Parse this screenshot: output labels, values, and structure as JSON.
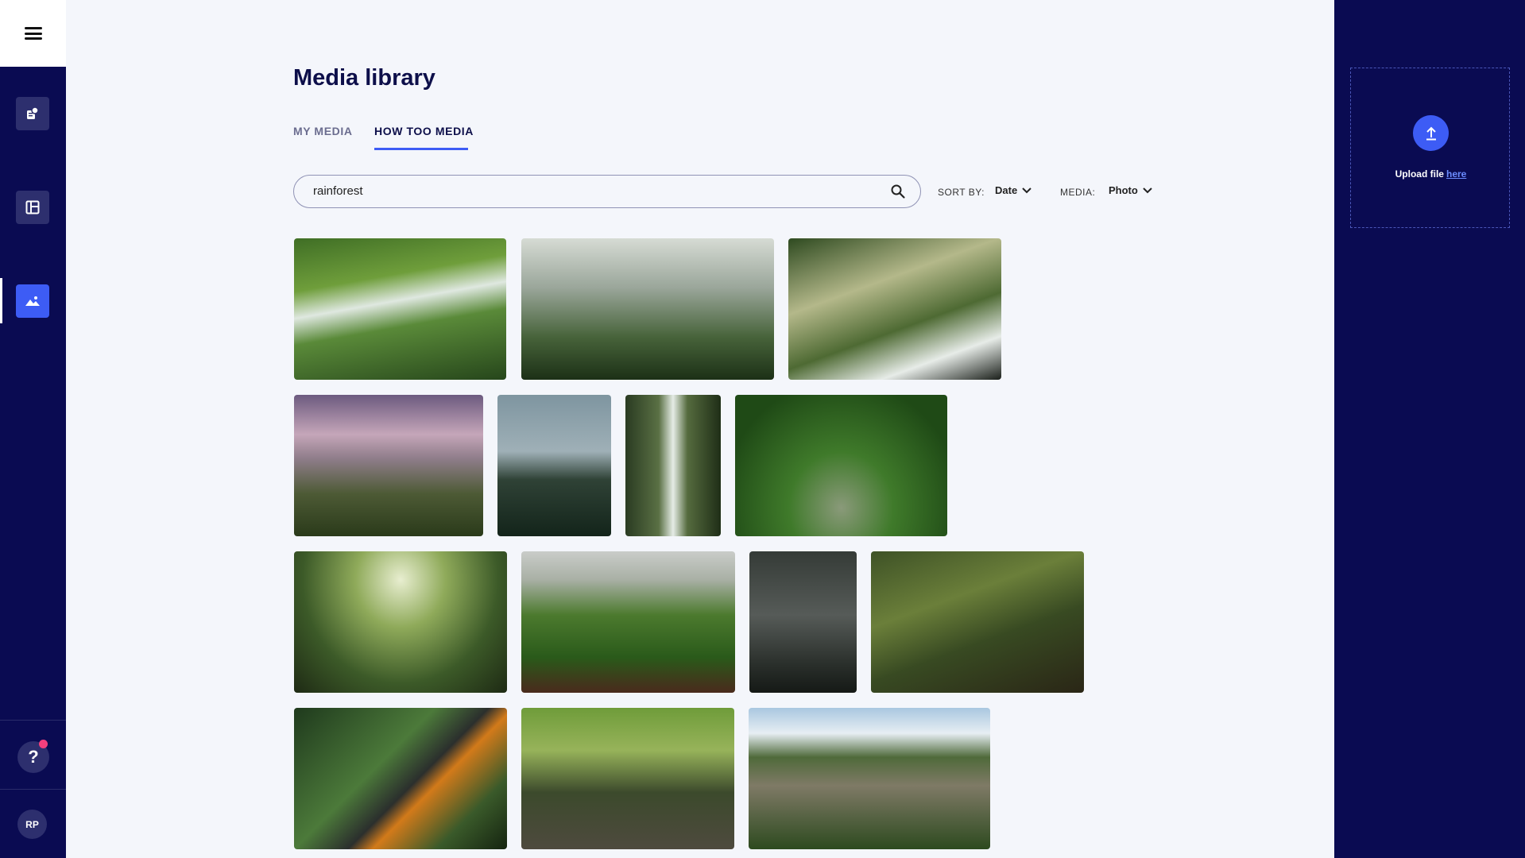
{
  "page": {
    "title": "Media library"
  },
  "tabs": [
    {
      "label": "MY MEDIA",
      "active": false
    },
    {
      "label": "HOW TOO MEDIA",
      "active": true
    }
  ],
  "search": {
    "value": "rainforest"
  },
  "filters": {
    "sort_label": "SORT BY:",
    "sort_value": "Date",
    "media_label": "MEDIA:",
    "media_value": "Photo"
  },
  "upload": {
    "text": "Upload file",
    "link": "here"
  },
  "user": {
    "initials": "RP"
  },
  "sidebar": {
    "items": [
      "posts-icon",
      "layout-icon",
      "image-icon"
    ],
    "active_item": "image-icon",
    "help_icon": "question-icon"
  },
  "colors": {
    "sidebar_bg": "#0a0b52",
    "accent": "#3d5cf5",
    "notification": "#f43f7d",
    "content_bg": "#f4f6fb"
  },
  "photos": [
    {
      "name": "mossy-waterfall-stream"
    },
    {
      "name": "misty-forest"
    },
    {
      "name": "sunrays-waterfall"
    },
    {
      "name": "sunset-mountains"
    },
    {
      "name": "foggy-canopy"
    },
    {
      "name": "jungle-waterfall"
    },
    {
      "name": "vine-archway-path"
    },
    {
      "name": "wooden-boardwalk"
    },
    {
      "name": "green-valley"
    },
    {
      "name": "dark-foggy-forest"
    },
    {
      "name": "forest-creek-bridge"
    },
    {
      "name": "toucan"
    },
    {
      "name": "sunlit-forest-stream"
    },
    {
      "name": "waterfall-cliff"
    }
  ]
}
